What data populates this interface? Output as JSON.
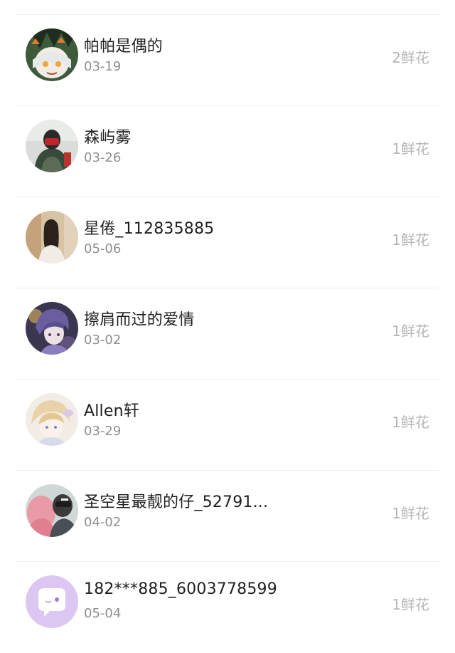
{
  "list": {
    "items": [
      {
        "name": "帕帕是偶的",
        "date": "03-19",
        "flowers": "2鲜花",
        "avatar": "anime-avatar-icon"
      },
      {
        "name": "森屿雾",
        "date": "03-26",
        "flowers": "1鲜花",
        "avatar": "masked-person-avatar-icon"
      },
      {
        "name": "星倦_112835885",
        "date": "05-06",
        "flowers": "1鲜花",
        "avatar": "girl-photo-avatar-icon"
      },
      {
        "name": "擦肩而过的爱情",
        "date": "03-02",
        "flowers": "1鲜花",
        "avatar": "purple-anime-avatar-icon"
      },
      {
        "name": "Allen轩",
        "date": "03-29",
        "flowers": "1鲜花",
        "avatar": "blonde-anime-avatar-icon"
      },
      {
        "name": "圣空星最靓的仔_52791...",
        "date": "04-02",
        "flowers": "1鲜花",
        "avatar": "couple-photo-avatar-icon"
      },
      {
        "name": "182***885_6003778599",
        "date": "05-04",
        "flowers": "1鲜花",
        "avatar": "default-chat-avatar-icon"
      }
    ]
  },
  "colors": {
    "name_text": "#1f1f1f",
    "date_text": "#8f8f8f",
    "flowers_text": "#b5b5b5",
    "divider": "#efefef",
    "default_avatar_bg": "#dcc6f2"
  }
}
